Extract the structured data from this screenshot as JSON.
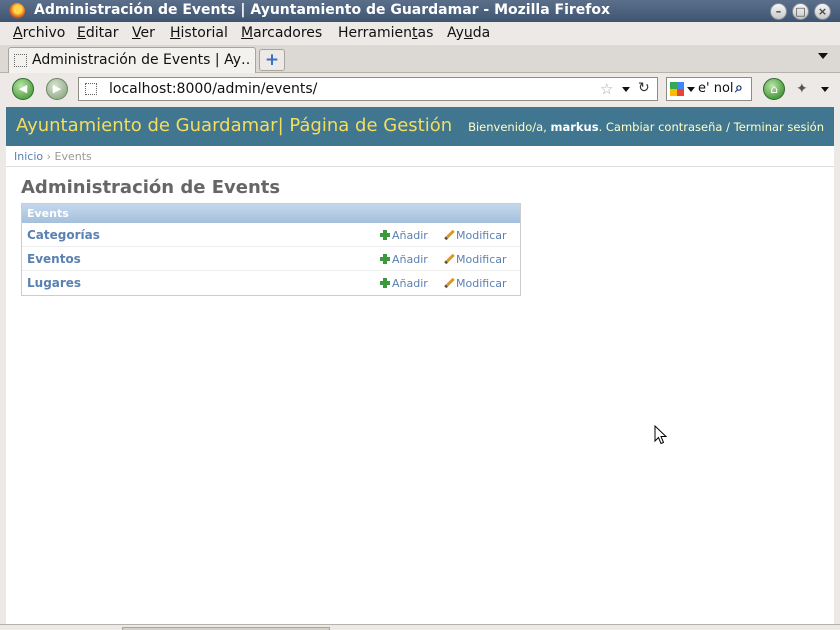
{
  "window": {
    "title": "Administración de Events | Ayuntamiento de Guardamar - Mozilla Firefox"
  },
  "menu": [
    {
      "label": "Archivo",
      "accel": "A",
      "rest": "rchivo"
    },
    {
      "label": "Editar",
      "accel": "E",
      "rest": "ditar"
    },
    {
      "label": "Ver",
      "accel": "V",
      "rest": "er"
    },
    {
      "label": "Historial",
      "accel": "H",
      "rest": "istorial"
    },
    {
      "label": "Marcadores",
      "accel": "M",
      "rest": "arcadores"
    },
    {
      "label": "Herramientas",
      "pre": "Herramien",
      "accel": "t",
      "rest": "as"
    },
    {
      "label": "Ayuda",
      "pre": "Ay",
      "accel": "u",
      "rest": "da"
    }
  ],
  "tab": {
    "label": "Administración de Events | Ay…"
  },
  "navbar": {
    "url": "localhost:8000/admin/events/",
    "search_text": "e' nol"
  },
  "site": {
    "branding": "Ayuntamiento de Guardamar| Página de Gestión",
    "welcome": "Bienvenido/a,",
    "username": "markus",
    "change_password": "Cambiar contraseña",
    "separator": "/",
    "logout": "Terminar sesión"
  },
  "breadcrumbs": {
    "home": "Inicio",
    "sep": "›",
    "current": "Events"
  },
  "page": {
    "title": "Administración de Events"
  },
  "module": {
    "caption": "Events",
    "add_label": "Añadir",
    "change_label": "Modificar",
    "rows": [
      {
        "name": "Categorías"
      },
      {
        "name": "Eventos"
      },
      {
        "name": "Lugares"
      }
    ]
  },
  "colors": {
    "header_bg": "#417690",
    "branding": "#f5dd5d",
    "link": "#5b80b2",
    "caption_bg": "#a4c0dc"
  }
}
